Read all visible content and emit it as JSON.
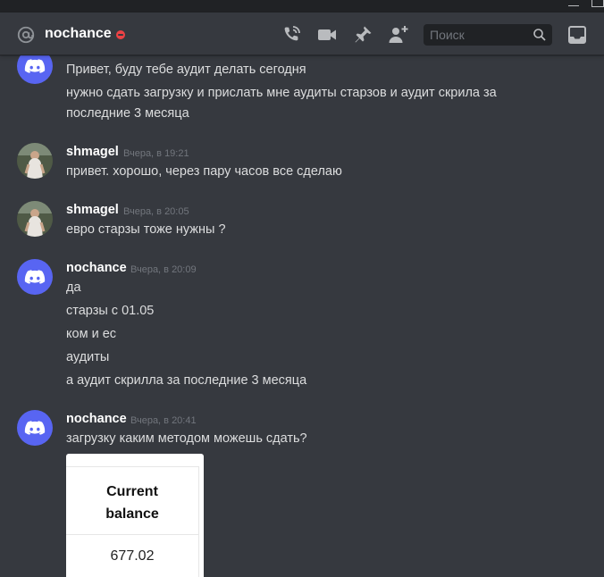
{
  "header": {
    "channel_name": "nochance",
    "status": "do-not-disturb",
    "search_placeholder": "Поиск",
    "icons": [
      "at-icon",
      "voice-call-icon",
      "video-call-icon",
      "pin-icon",
      "add-friend-icon",
      "search-icon",
      "inbox-icon"
    ]
  },
  "colors": {
    "background": "#36393f",
    "header_bg": "#36393f",
    "search_bg": "#202225",
    "discord_blurple": "#5865f2",
    "dnd_red": "#ed4245",
    "username": "#ffffff",
    "timestamp": "#72767d",
    "message_text": "#dcddde"
  },
  "messages": [
    {
      "avatar": "discord-logo",
      "lines": [
        "Привет, буду тебе аудит делать сегодня",
        "нужно сдать загрузку и прислать мне аудиты старзов и аудит скрила за",
        "последние 3 месяца"
      ]
    },
    {
      "author": "shmagel",
      "timestamp": "Вчера, в 19:21",
      "avatar": "user-photo",
      "lines": [
        "привет. хорошо, через пару часов все сделаю"
      ]
    },
    {
      "author": "shmagel",
      "timestamp": "Вчера, в 20:05",
      "avatar": "user-photo",
      "lines": [
        "евро старзы тоже нужны ?"
      ]
    },
    {
      "author": "nochance",
      "timestamp": "Вчера, в 20:09",
      "avatar": "discord-logo",
      "lines": [
        "да",
        "старзы с 01.05",
        "ком и ес",
        "аудиты",
        "а аудит скрилла за последние 3 месяца"
      ]
    },
    {
      "author": "nochance",
      "timestamp": "Вчера, в 20:41",
      "avatar": "discord-logo",
      "lines": [
        "загрузку каким методом можешь сдать?"
      ]
    }
  ],
  "embed": {
    "title_line1": "Current",
    "title_line2": "balance",
    "value": "677.02"
  }
}
